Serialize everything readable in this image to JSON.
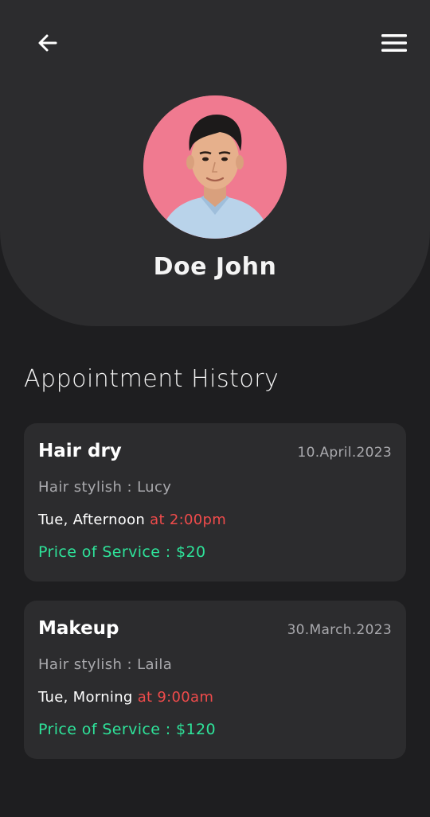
{
  "header": {
    "back_icon": "arrow-left-icon",
    "menu_icon": "hamburger-menu-icon"
  },
  "profile": {
    "name": "Doe John",
    "avatar_bg": "#f07a90"
  },
  "history": {
    "title": "Appointment History",
    "appointments": [
      {
        "service": "Hair dry",
        "date": "10.April.2023",
        "stylist": "Hair stylish : Lucy",
        "day_time": "Tue, Afternoon",
        "at_time": "at 2:00pm",
        "price": "Price of Service : $20"
      },
      {
        "service": "Makeup",
        "date": "30.March.2023",
        "stylist": "Hair stylish : Laila",
        "day_time": "Tue, Morning",
        "at_time": "at 9:00am",
        "price": "Price of Service : $120"
      }
    ]
  },
  "colors": {
    "background": "#1e1e20",
    "card": "#2c2c2e",
    "price": "#2ee39a",
    "time_accent": "#ef4b4b",
    "muted": "#a9a9ad"
  }
}
